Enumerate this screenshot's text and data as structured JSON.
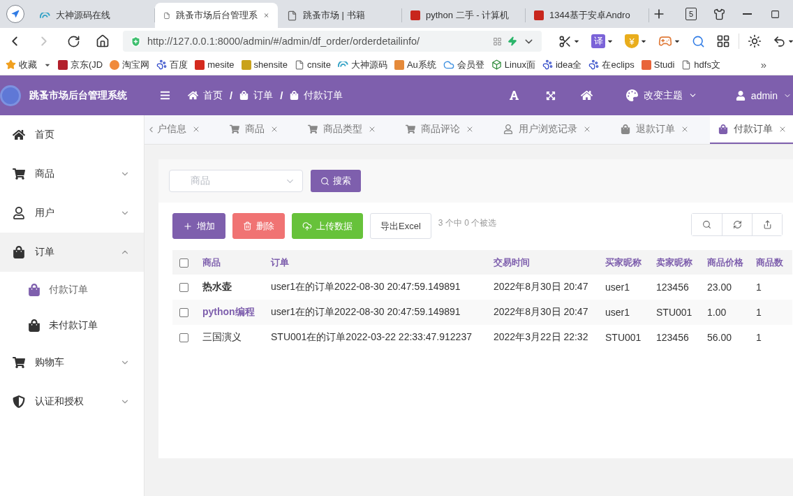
{
  "browser": {
    "tabs": [
      {
        "title": "大神源码在线",
        "selected": false
      },
      {
        "title": "跳蚤市场后台管理系",
        "selected": true
      },
      {
        "title": "跳蚤市场 | 书籍",
        "selected": false
      },
      {
        "title": "python 二手 - 计算机",
        "selected": false
      },
      {
        "title": "1344基于安卓Andro",
        "selected": false
      }
    ],
    "tab_count": "5",
    "forward_disabled": true,
    "url": "http://127.0.0.1:8000/admin/#/admin/df_order/orderdetailinfo/",
    "extensions": [
      "译",
      "¥"
    ],
    "bookmarks": [
      "收藏",
      "京东(JD",
      "淘宝网",
      "百度",
      "mesite",
      "shensite",
      "cnsite",
      "大神源码",
      "Au系统",
      "会员登",
      "Linux面",
      "idea全",
      "在eclips",
      "Studi",
      "hdfs文"
    ],
    "bookmarks_more": "»"
  },
  "header": {
    "title": "跳蚤市场后台管理系统",
    "breadcrumb": [
      "首页",
      "订单",
      "付款订单"
    ],
    "breadcrumb_separator": "/",
    "theme_menu": "改变主题",
    "user_menu": "admin"
  },
  "sidebar": {
    "items": [
      {
        "label": "首页",
        "selected": false
      },
      {
        "label": "商品",
        "selected": false,
        "expanded": false
      },
      {
        "label": "用户",
        "selected": false,
        "expanded": false
      },
      {
        "label": "订单",
        "selected": false,
        "expanded": true,
        "children": [
          {
            "label": "付款订单",
            "selected": true
          },
          {
            "label": "未付款订单",
            "selected": false
          }
        ]
      },
      {
        "label": "购物车",
        "selected": false,
        "expanded": false
      },
      {
        "label": "认证和授权",
        "selected": false,
        "expanded": false
      }
    ]
  },
  "tabs": [
    {
      "label": "户信息",
      "selected": false
    },
    {
      "label": "商品",
      "selected": false
    },
    {
      "label": "商品类型",
      "selected": false
    },
    {
      "label": "商品评论",
      "selected": false
    },
    {
      "label": "用户浏览记录",
      "selected": false
    },
    {
      "label": "退款订单",
      "selected": false
    },
    {
      "label": "付款订单",
      "selected": true
    }
  ],
  "search": {
    "placeholder": "商品",
    "button": "搜索"
  },
  "actions": [
    {
      "label": "增加",
      "kind": "add"
    },
    {
      "label": "删除",
      "kind": "delete"
    },
    {
      "label": "上传数据",
      "kind": "upload"
    },
    {
      "label": "导出Excel",
      "kind": "export"
    }
  ],
  "selection_summary": "3 个中 0 个被选",
  "table": {
    "select_all": {
      "checked": false
    },
    "columns": [
      "商品",
      "订单",
      "交易时间",
      "买家昵称",
      "卖家昵称",
      "商品价格",
      "商品数"
    ],
    "rows": [
      {
        "checked": false,
        "kind": "bold",
        "cells": [
          "热水壶",
          "user1在的订单2022-08-30 20:47:59.149891",
          "2022年8月30日 20:47",
          "user1",
          "123456",
          "23.00",
          "1"
        ]
      },
      {
        "checked": false,
        "kind": "link",
        "cells": [
          "python编程",
          "user1在的订单2022-08-30 20:47:59.149891",
          "2022年8月30日 20:47",
          "user1",
          "STU001",
          "1.00",
          "1"
        ]
      },
      {
        "checked": false,
        "kind": "plain",
        "cells": [
          "三国演义",
          "STU001在的订单2022-03-22 22:33:47.912237",
          "2022年3月22日 22:32",
          "STU001",
          "123456",
          "56.00",
          "1"
        ]
      }
    ]
  }
}
